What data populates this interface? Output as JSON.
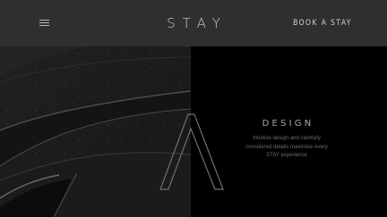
{
  "header": {
    "menu_icon": "hamburger-menu-icon",
    "logo_text": "STAY",
    "book_label": "BOOK A STAY"
  },
  "photo": {
    "description_icon": "architecture-photo"
  },
  "feature": {
    "title": "DESIGN",
    "description_lines": [
      "Intuitive design and carefully",
      "considered details maximise every",
      "STAY experience"
    ],
    "overlay_icon": "logo-a-outline-icon"
  },
  "colors": {
    "header_bg": "#2f2f30",
    "panel_bg": "#000000",
    "logo_text": "#cfcfcf",
    "muted_text": "#6a6a6a"
  }
}
